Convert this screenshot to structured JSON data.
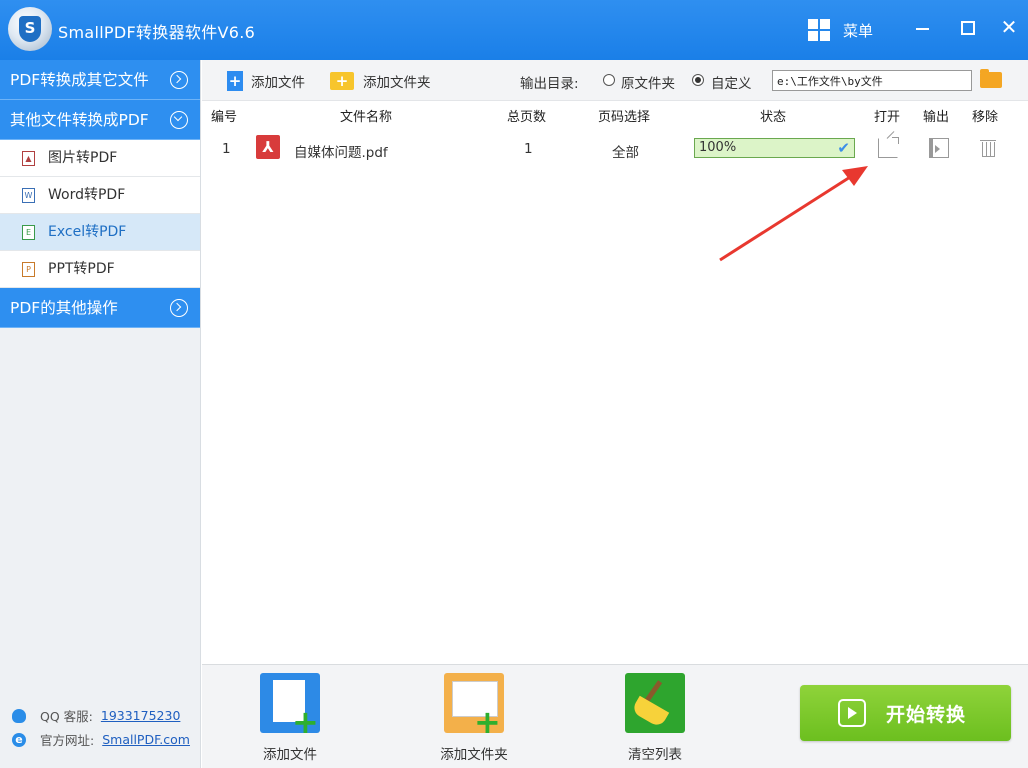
{
  "app": {
    "title": "SmallPDF转换器软件V6.6",
    "logo_letter": "S",
    "menu_label": "菜单",
    "close_glyph": "✕"
  },
  "sidebar": {
    "sections": [
      {
        "label": "PDF转换成其它文件",
        "expanded": false
      },
      {
        "label": "其他文件转换成PDF",
        "expanded": true
      },
      {
        "label": "PDF的其他操作",
        "expanded": false
      }
    ],
    "items": [
      {
        "label": "图片转PDF",
        "icon": "image-file-icon",
        "active": false
      },
      {
        "label": "Word转PDF",
        "icon": "word-file-icon",
        "active": false
      },
      {
        "label": "Excel转PDF",
        "icon": "excel-file-icon",
        "active": true
      },
      {
        "label": "PPT转PDF",
        "icon": "ppt-file-icon",
        "active": false
      }
    ],
    "footer": {
      "qq_label": "QQ 客服:",
      "qq_number": "1933175230",
      "site_label": "官方网址:",
      "site_url": "SmallPDF.com"
    }
  },
  "toolbar": {
    "add_file": "添加文件",
    "add_folder": "添加文件夹",
    "output_label": "输出目录:",
    "option_original": "原文件夹",
    "option_custom": "自定义",
    "selected_option": "自定义",
    "output_path": "e:\\工作文件\\by文件"
  },
  "table": {
    "headers": [
      "编号",
      "文件名称",
      "总页数",
      "页码选择",
      "状态",
      "打开",
      "输出",
      "移除"
    ],
    "rows": [
      {
        "index": "1",
        "filename": "自媒体问题.pdf",
        "pages": "1",
        "page_selection": "全部",
        "status": "100%",
        "progress": 100
      }
    ]
  },
  "bottom": {
    "add_file": "添加文件",
    "add_folder": "添加文件夹",
    "clear_list": "清空列表",
    "start": "开始转换"
  },
  "colors": {
    "primary": "#2e8ff0",
    "sidebar_active": "#d6e8f8",
    "progress_fill": "#dcf4c8",
    "start_button": "#7ac72b",
    "annotation_arrow": "#e8382f"
  }
}
